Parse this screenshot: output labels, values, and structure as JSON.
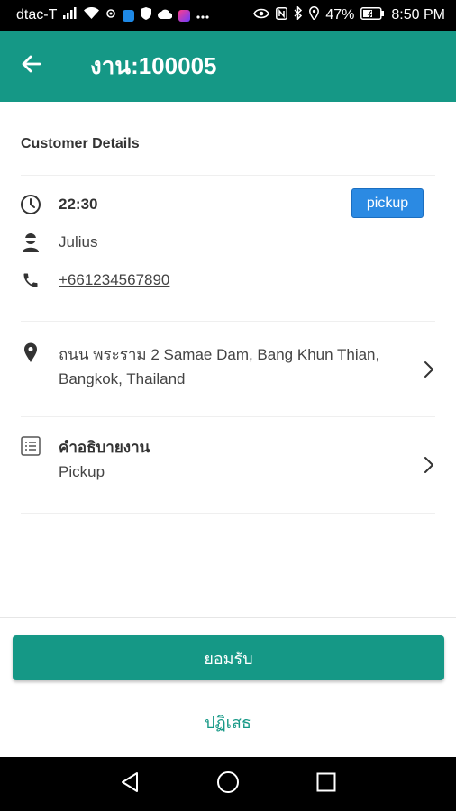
{
  "status_bar": {
    "carrier": "dtac-T",
    "battery": "47%",
    "time": "8:50 PM"
  },
  "app_bar": {
    "title": "งาน:100005"
  },
  "customer": {
    "section_title": "Customer Details",
    "time": "22:30",
    "type_badge": "pickup",
    "name": "Julius",
    "phone": "+661234567890"
  },
  "address": {
    "line1": "ถนน พระราม 2 Samae Dam, Bang Khun Thian,",
    "line2": "Bangkok, Thailand"
  },
  "job_description": {
    "label": "คำอธิบายงาน",
    "value": "Pickup"
  },
  "actions": {
    "accept_label": "ยอมรับ",
    "reject_label": "ปฏิเสธ"
  },
  "colors": {
    "primary": "#159886",
    "badge": "#2b8ae3"
  }
}
